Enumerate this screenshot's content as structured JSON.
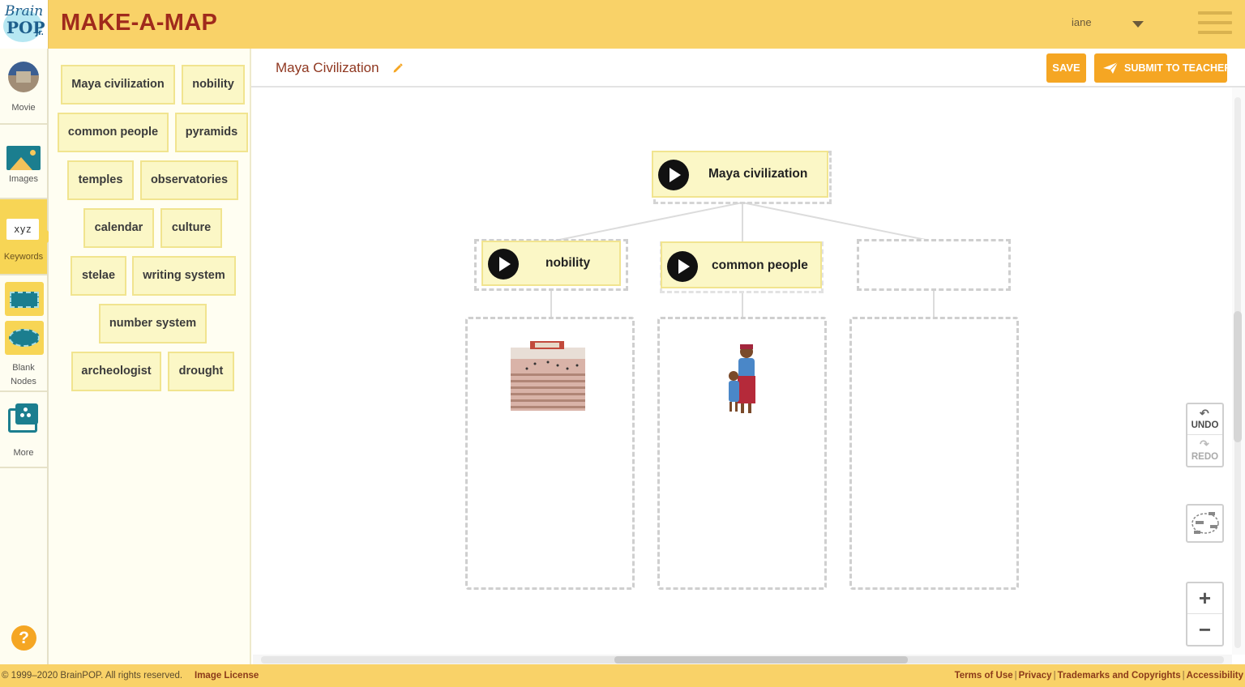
{
  "header": {
    "logo_brain": "Brain",
    "logo_pop": "POP",
    "logo_jr": "Jr.",
    "app_title": "MAKE-A-MAP",
    "user_name": "iane"
  },
  "rail": {
    "movie_label": "Movie",
    "images_label": "Images",
    "keywords_icon_text": "xyz",
    "keywords_label": "Keywords",
    "blank_label_1": "Blank",
    "blank_label_2": "Nodes",
    "more_label": "More",
    "help_text": "?"
  },
  "keywords": [
    "Maya civilization",
    "nobility",
    "common people",
    "pyramids",
    "temples",
    "observatories",
    "calendar",
    "culture",
    "stelae",
    "writing system",
    "number system",
    "archeologist",
    "drought"
  ],
  "toolbar": {
    "map_title": "Maya Civilization",
    "save_label": "SAVE",
    "submit_label": "SUBMIT TO TEACHER"
  },
  "map": {
    "root_label": "Maya civilization",
    "child_1_label": "nobility",
    "child_2_label": "common people"
  },
  "tools": {
    "undo_label": "UNDO",
    "redo_label": "REDO",
    "zoom_in": "+",
    "zoom_out": "−"
  },
  "footer": {
    "copyright": "© 1999–2020 BrainPOP. All rights reserved.",
    "image_license": "Image License",
    "links": [
      "Terms of Use",
      "Privacy",
      "Trademarks and Copyrights",
      "Accessibility"
    ]
  },
  "colors": {
    "header_bg": "#f9d268",
    "title_red": "#a02a1c",
    "accent_orange": "#f5a623",
    "node_fill": "#fbf7c6",
    "teal": "#1b7e8f"
  }
}
